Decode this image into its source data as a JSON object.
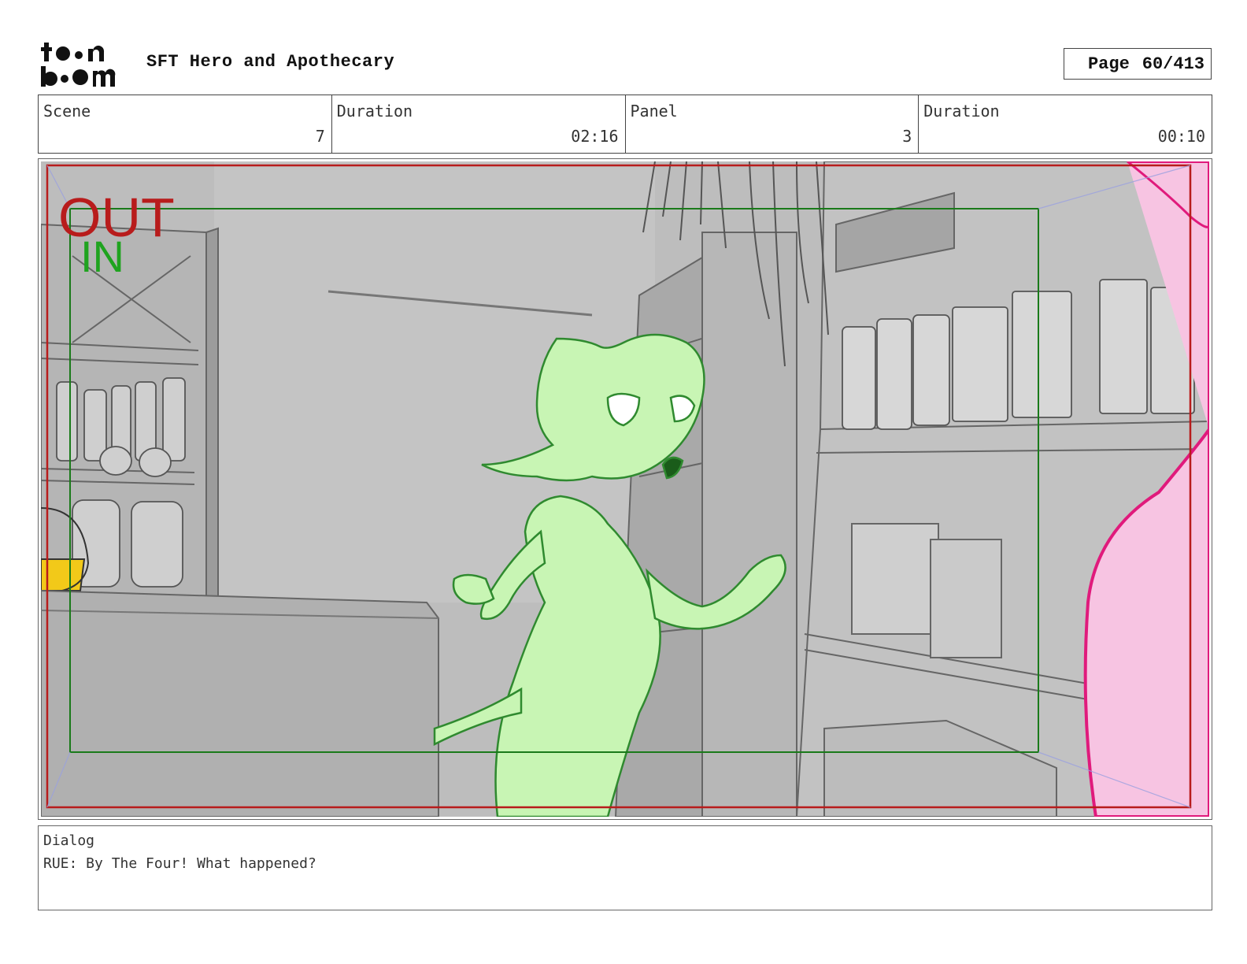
{
  "header": {
    "logo_line1": "toon",
    "logo_line2": "boom",
    "project_title": "SFT Hero and Apothecary",
    "page_label": "Page",
    "page_number": "60/413"
  },
  "info": {
    "scene_label": "Scene",
    "scene_value": "7",
    "scene_duration_label": "Duration",
    "scene_duration_value": "02:16",
    "panel_label": "Panel",
    "panel_value": "3",
    "panel_duration_label": "Duration",
    "panel_duration_value": "00:10"
  },
  "panel": {
    "out_label": "OUT",
    "in_label": "IN",
    "colors": {
      "out_frame": "#b81c1c",
      "in_frame": "#1a7a1a",
      "character_fill": "#c8f5b4",
      "character_line": "#2f8a2f",
      "offscreen_character": "#f7c4e2",
      "offscreen_line": "#e01a7c",
      "background": "#b9b9b9"
    }
  },
  "dialog": {
    "label": "Dialog",
    "text": "RUE: By The Four! What happened?"
  }
}
